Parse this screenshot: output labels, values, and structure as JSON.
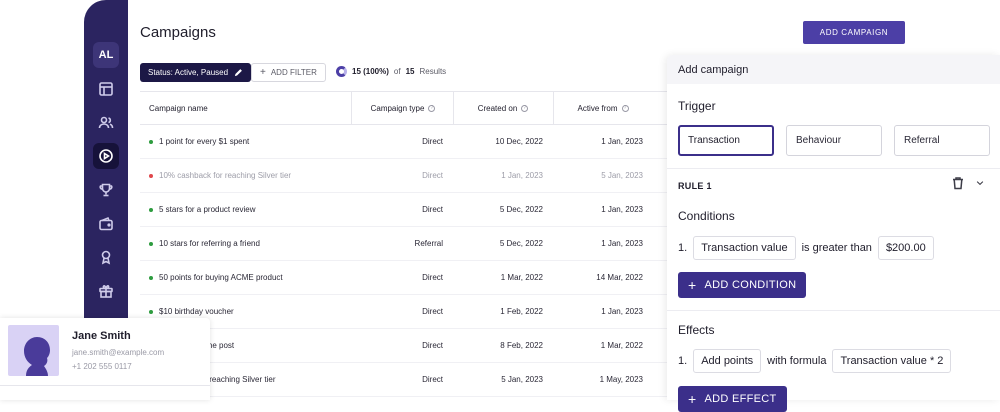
{
  "header": {
    "title": "Campaigns",
    "add_button": "ADD CAMPAIGN"
  },
  "sidebar": {
    "avatar": "AL",
    "icons": [
      "layout-icon",
      "users-icon",
      "play-circle-icon",
      "trophy-icon",
      "wallet-icon",
      "badge-icon",
      "gift-icon"
    ],
    "active": "play-circle-icon"
  },
  "filters": {
    "status_chip": "Status: Active, Paused",
    "add_filter": "ADD FILTER",
    "results_bold": "15 (100%)",
    "results_mid": "of",
    "results_total": "15",
    "results_suffix": "Results"
  },
  "table": {
    "columns": [
      "Campaign name",
      "Campaign type",
      "Created on",
      "Active from"
    ],
    "rows": [
      {
        "status": "active",
        "name": "1 point for every $1 spent",
        "type": "Direct",
        "created": "10 Dec, 2022",
        "active_from": "1 Jan, 2023"
      },
      {
        "status": "paused",
        "name": "10% cashback for reaching Silver tier",
        "type": "Direct",
        "created": "1 Jan, 2023",
        "active_from": "5 Jan, 2023"
      },
      {
        "status": "active",
        "name": "5 stars for a product review",
        "type": "Direct",
        "created": "5 Dec, 2022",
        "active_from": "1 Jan, 2023"
      },
      {
        "status": "active",
        "name": "10 stars for referring a friend",
        "type": "Referral",
        "created": "5 Dec, 2022",
        "active_from": "1 Jan, 2023"
      },
      {
        "status": "active",
        "name": "50 points for buying ACME product",
        "type": "Direct",
        "created": "1 Mar, 2022",
        "active_from": "14 Mar, 2022"
      },
      {
        "status": "active",
        "name": "$10 birthday voucher",
        "type": "Direct",
        "created": "1 Feb, 2022",
        "active_from": "1 Jan, 2023"
      },
      {
        "status": "active",
        "name": "ts for sharng the post",
        "type": "Direct",
        "created": "8 Feb, 2022",
        "active_from": "1 Mar, 2022"
      },
      {
        "status": "active",
        "name": "ck coupon for reaching Silver tier",
        "type": "Direct",
        "created": "5 Jan, 2023",
        "active_from": "1 May, 2023"
      }
    ]
  },
  "panel": {
    "title": "Add campaign",
    "trigger_label": "Trigger",
    "triggers": [
      "Transaction",
      "Behaviour",
      "Referral"
    ],
    "selected_trigger": "Transaction",
    "rule_title": "RULE 1",
    "conditions_label": "Conditions",
    "condition": {
      "index": "1.",
      "field": "Transaction value",
      "operator": "is greater than",
      "value": "$200.00"
    },
    "add_condition": "ADD CONDITION",
    "effects_label": "Effects",
    "effect": {
      "index": "1.",
      "action": "Add points",
      "connector": "with formula",
      "formula": "Transaction value * 2"
    },
    "add_effect": "ADD EFFECT"
  },
  "contact": {
    "name": "Jane Smith",
    "email": "jane.smith@example.com",
    "phone": "+1 202 555 0117"
  },
  "colors": {
    "sidebar": "#2b2460",
    "primary": "#4c3fa6",
    "active_dot": "#2e9c3f",
    "paused_dot": "#e0474c"
  }
}
